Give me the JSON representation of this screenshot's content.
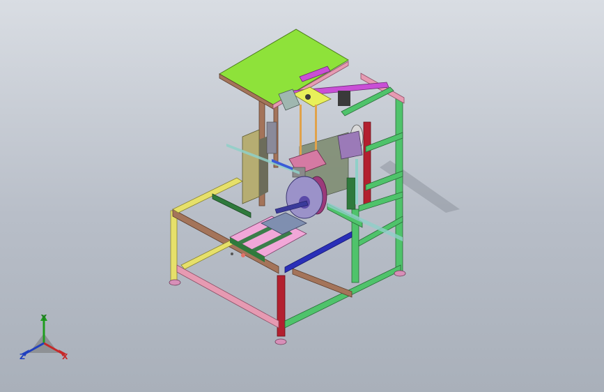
{
  "triad": {
    "x_label": "X",
    "y_label": "Y",
    "z_label": "Z",
    "colors": {
      "x": "#c62828",
      "y": "#1f9d1f",
      "z": "#1f3fbf"
    }
  },
  "model": {
    "colors": {
      "top_plate": "#8ee23a",
      "frame_pink": "#e69ab2",
      "frame_green": "#4fc36b",
      "frame_yellow": "#e6e06a",
      "frame_brown": "#a4745a",
      "frame_red": "#b3202f",
      "frame_blue": "#2a2fb8",
      "frame_dark_green": "#2f7a3c",
      "rail_magenta": "#c94fd6",
      "rail_pink": "#f1a7d8",
      "plate_khaki": "#b6ad72",
      "bracket_cyan": "#8fd0c8",
      "disc_purple": "#9b92c9",
      "motor_orange": "#e0a24a",
      "foot_pink": "#d78fb8"
    }
  }
}
